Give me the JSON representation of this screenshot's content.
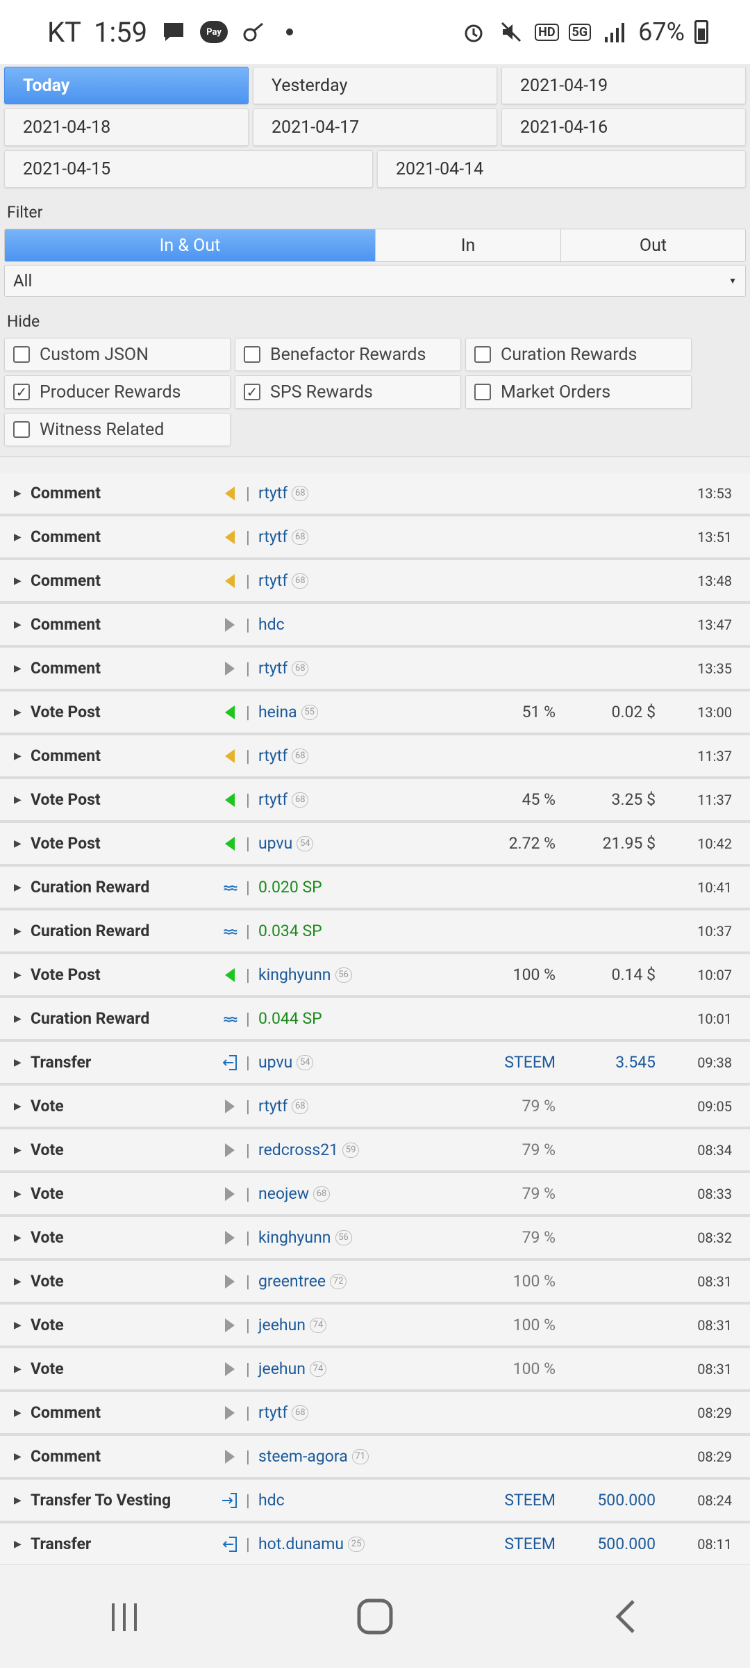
{
  "status_bar": {
    "carrier": "KT",
    "clock": "1:59",
    "battery": "67%",
    "network": "5G",
    "hd": "HD"
  },
  "dates": [
    [
      "Today",
      "Yesterday",
      "2021-04-19"
    ],
    [
      "2021-04-18",
      "2021-04-17",
      "2021-04-16"
    ],
    [
      "2021-04-15",
      "2021-04-14"
    ]
  ],
  "filter": {
    "label": "Filter",
    "options": [
      "In & Out",
      "In",
      "Out"
    ],
    "active": "In & Out",
    "select_value": "All"
  },
  "hide": {
    "label": "Hide",
    "items": [
      {
        "label": "Custom JSON",
        "checked": false
      },
      {
        "label": "Benefactor Rewards",
        "checked": false
      },
      {
        "label": "Curation Rewards",
        "checked": false
      },
      {
        "label": "Producer Rewards",
        "checked": true
      },
      {
        "label": "SPS Rewards",
        "checked": true
      },
      {
        "label": "Market Orders",
        "checked": false
      },
      {
        "label": "Witness Related",
        "checked": false
      }
    ]
  },
  "rows": [
    {
      "type": "Comment",
      "dir": "in-gold",
      "who": "rtytf",
      "rep": "68",
      "pct": "",
      "amt": "",
      "time": "13:53"
    },
    {
      "type": "Comment",
      "dir": "in-gold",
      "who": "rtytf",
      "rep": "68",
      "pct": "",
      "amt": "",
      "time": "13:51"
    },
    {
      "type": "Comment",
      "dir": "in-gold",
      "who": "rtytf",
      "rep": "68",
      "pct": "",
      "amt": "",
      "time": "13:48"
    },
    {
      "type": "Comment",
      "dir": "out-gray",
      "who": "hdc",
      "rep": "",
      "pct": "",
      "amt": "",
      "time": "13:47"
    },
    {
      "type": "Comment",
      "dir": "out-gray",
      "who": "rtytf",
      "rep": "68",
      "pct": "",
      "amt": "",
      "time": "13:35"
    },
    {
      "type": "Vote Post",
      "dir": "in-green",
      "who": "heina",
      "rep": "55",
      "pct": "51 %",
      "amt": "0.02 $",
      "time": "13:00"
    },
    {
      "type": "Comment",
      "dir": "in-gold",
      "who": "rtytf",
      "rep": "68",
      "pct": "",
      "amt": "",
      "time": "11:37"
    },
    {
      "type": "Vote Post",
      "dir": "in-green",
      "who": "rtytf",
      "rep": "68",
      "pct": "45 %",
      "amt": "3.25 $",
      "time": "11:37"
    },
    {
      "type": "Vote Post",
      "dir": "in-green",
      "who": "upvu",
      "rep": "54",
      "pct": "2.72 %",
      "amt": "21.95 $",
      "time": "10:42"
    },
    {
      "type": "Curation Reward",
      "dir": "steem",
      "who": "0.020 SP",
      "rep": "",
      "pct": "",
      "amt": "",
      "time": "10:41",
      "green": true
    },
    {
      "type": "Curation Reward",
      "dir": "steem",
      "who": "0.034 SP",
      "rep": "",
      "pct": "",
      "amt": "",
      "time": "10:37",
      "green": true
    },
    {
      "type": "Vote Post",
      "dir": "in-green",
      "who": "kinghyunn",
      "rep": "56",
      "pct": "100 %",
      "amt": "0.14 $",
      "time": "10:07"
    },
    {
      "type": "Curation Reward",
      "dir": "steem",
      "who": "0.044 SP",
      "rep": "",
      "pct": "",
      "amt": "",
      "time": "10:01",
      "green": true
    },
    {
      "type": "Transfer",
      "dir": "xfer-in",
      "who": "upvu",
      "rep": "54",
      "pct": "STEEM",
      "amt": "3.545",
      "time": "09:38",
      "blue": true
    },
    {
      "type": "Vote",
      "dir": "out-gray",
      "who": "rtytf",
      "rep": "68",
      "pct": "79 %",
      "amt": "",
      "time": "09:05",
      "muted": true
    },
    {
      "type": "Vote",
      "dir": "out-gray",
      "who": "redcross21",
      "rep": "59",
      "pct": "79 %",
      "amt": "",
      "time": "08:34",
      "muted": true
    },
    {
      "type": "Vote",
      "dir": "out-gray",
      "who": "neojew",
      "rep": "68",
      "pct": "79 %",
      "amt": "",
      "time": "08:33",
      "muted": true
    },
    {
      "type": "Vote",
      "dir": "out-gray",
      "who": "kinghyunn",
      "rep": "56",
      "pct": "79 %",
      "amt": "",
      "time": "08:32",
      "muted": true
    },
    {
      "type": "Vote",
      "dir": "out-gray",
      "who": "greentree",
      "rep": "72",
      "pct": "100 %",
      "amt": "",
      "time": "08:31",
      "muted": true
    },
    {
      "type": "Vote",
      "dir": "out-gray",
      "who": "jeehun",
      "rep": "74",
      "pct": "100 %",
      "amt": "",
      "time": "08:31",
      "muted": true
    },
    {
      "type": "Vote",
      "dir": "out-gray",
      "who": "jeehun",
      "rep": "74",
      "pct": "100 %",
      "amt": "",
      "time": "08:31",
      "muted": true
    },
    {
      "type": "Comment",
      "dir": "out-gray",
      "who": "rtytf",
      "rep": "68",
      "pct": "",
      "amt": "",
      "time": "08:29"
    },
    {
      "type": "Comment",
      "dir": "out-gray",
      "who": "steem-agora",
      "rep": "71",
      "pct": "",
      "amt": "",
      "time": "08:29"
    },
    {
      "type": "Transfer To Vesting",
      "dir": "xfer-out",
      "who": "hdc",
      "rep": "",
      "pct": "STEEM",
      "amt": "500.000",
      "time": "08:24",
      "blue": true
    },
    {
      "type": "Transfer",
      "dir": "xfer-in",
      "who": "hot.dunamu",
      "rep": "25",
      "pct": "STEEM",
      "amt": "500.000",
      "time": "08:11",
      "blue": true
    }
  ],
  "nav": {
    "icons": [
      "recent-apps-icon",
      "home-icon",
      "back-icon"
    ]
  }
}
